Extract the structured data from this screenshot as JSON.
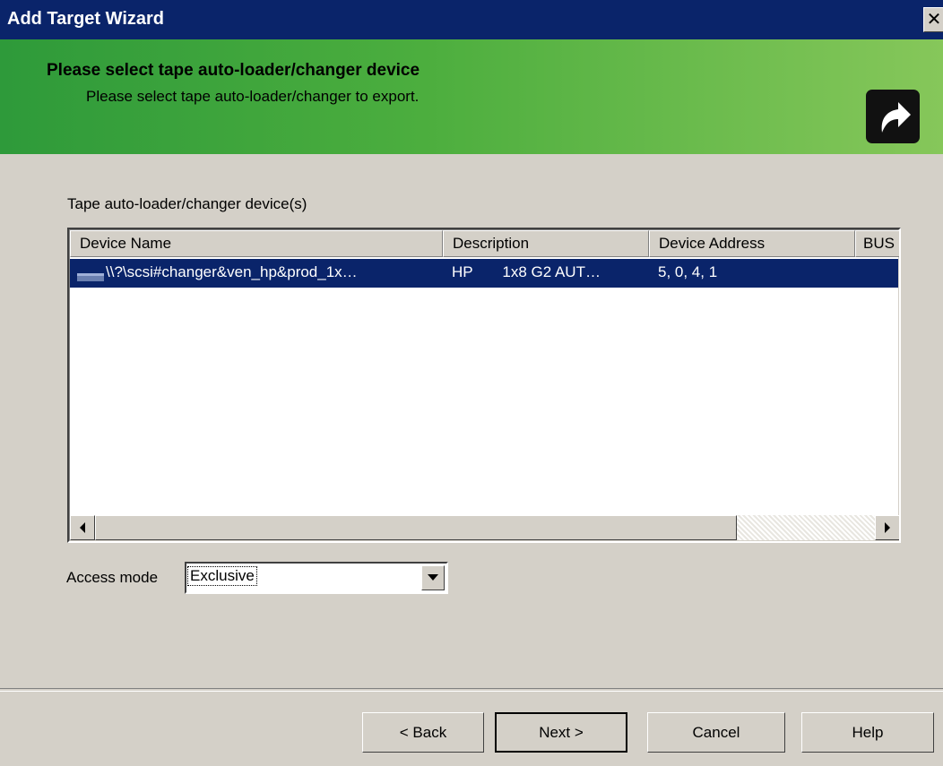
{
  "window": {
    "title": "Add Target Wizard",
    "close_glyph": "✕"
  },
  "banner": {
    "title": "Please select tape auto-loader/changer device",
    "subtitle": "Please select tape auto-loader/changer to export.",
    "icon": "export-arrow-icon"
  },
  "devices": {
    "label": "Tape auto-loader/changer device(s)",
    "columns": [
      "Device Name",
      "Description",
      "Device Address",
      "BUS"
    ],
    "rows": [
      {
        "icon": "tape-changer-icon",
        "name": "\\\\?\\scsi#changer&ven_hp&prod_1x…",
        "description": "HP       1x8 G2 AUT…",
        "address": "5, 0, 4, 1",
        "selected": true
      }
    ]
  },
  "access_mode": {
    "label": "Access mode",
    "value": "Exclusive"
  },
  "buttons": {
    "back": "< Back",
    "next": "Next >",
    "cancel": "Cancel",
    "help": "Help"
  },
  "colors": {
    "titlebar": "#0a246a",
    "selection": "#0a246a",
    "banner_start": "#2e9a3a",
    "banner_end": "#86c75a",
    "dialog_bg": "#d4d0c8"
  }
}
